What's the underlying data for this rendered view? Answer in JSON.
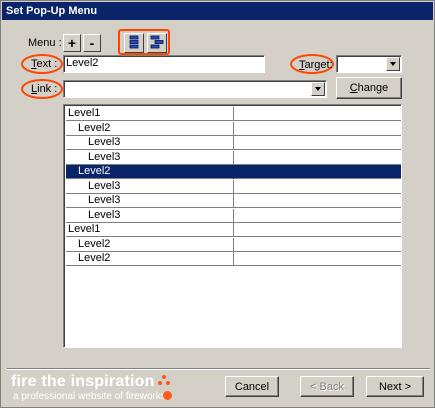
{
  "window": {
    "title": "Set Pop-Up Menu"
  },
  "menu_row": {
    "label": "Menu :",
    "add_label": "+",
    "remove_label": "-"
  },
  "text_field": {
    "label_prefix": "",
    "label_access": "T",
    "label_rest": "ext :",
    "value": "Level2"
  },
  "target_field": {
    "label_access": "T",
    "label_rest": "arget:",
    "value": ""
  },
  "link_field": {
    "label_access": "L",
    "label_rest": "ink :",
    "value": ""
  },
  "change_button": {
    "label_access": "C",
    "label_rest": "hange"
  },
  "menu_items": [
    {
      "text": "Level1",
      "level": 1
    },
    {
      "text": "Level2",
      "level": 2
    },
    {
      "text": "Level3",
      "level": 3
    },
    {
      "text": "Level3",
      "level": 3
    },
    {
      "text": "Level2",
      "level": 2,
      "selected": true
    },
    {
      "text": "Level3",
      "level": 3
    },
    {
      "text": "Level3",
      "level": 3
    },
    {
      "text": "Level3",
      "level": 3
    },
    {
      "text": "Level1",
      "level": 1
    },
    {
      "text": "Level2",
      "level": 2
    },
    {
      "text": "Level2",
      "level": 2
    }
  ],
  "branding": {
    "headline": "fire the inspiration",
    "tagline": "a professional website of fireworks"
  },
  "footer": {
    "cancel": "Cancel",
    "back": "< Back",
    "next": "Next >"
  },
  "colors": {
    "selection": "#0a246a",
    "highlight": "#ff4500",
    "dialog": "#d4d0c8"
  },
  "icons": {
    "indent_left": "outdent-icon",
    "indent_right": "indent-icon"
  }
}
